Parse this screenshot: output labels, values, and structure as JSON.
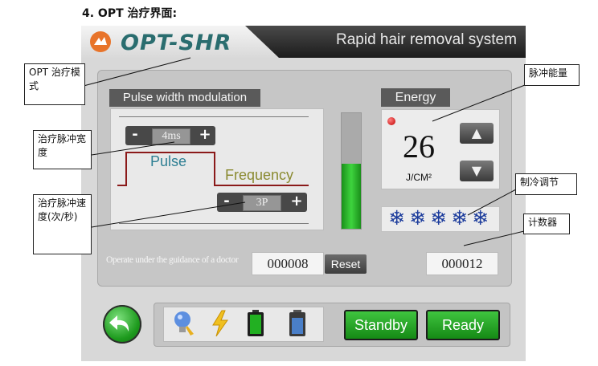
{
  "heading": "4. OPT 治疗界面:",
  "header": {
    "logo_text": "OPT-SHR",
    "subtitle": "Rapid hair removal system"
  },
  "pulse_width_modulation": {
    "label": "Pulse width modulation",
    "pulse_width_value": "4ms",
    "pulse_label": "Pulse",
    "frequency_label": "Frequency",
    "frequency_value": "3P",
    "minus": "-",
    "plus": "+"
  },
  "power_meter": {
    "level": 0.56,
    "color": "#2fb82f"
  },
  "energy": {
    "label": "Energy",
    "value": "26",
    "unit": "J/CM²",
    "up_icon": "triangle-up-icon",
    "down_icon": "triangle-down-icon"
  },
  "cooling": {
    "level_icons": [
      "snowflake-icon",
      "snowflake-icon",
      "snowflake-icon",
      "snowflake-icon",
      "snowflake-icon"
    ],
    "glyph": "❄"
  },
  "bottom": {
    "guidance": "Operate under the guidance of a doctor",
    "counter_1": "000008",
    "reset_label": "Reset",
    "counter_2": "000012"
  },
  "toolbar": {
    "icons": [
      "back-arrow-icon",
      "light-bulb-icon",
      "lightning-icon",
      "battery-icon",
      "water-tank-icon"
    ],
    "standby_label": "Standby",
    "ready_label": "Ready"
  },
  "callouts": {
    "mode": "OPT  治疗模式",
    "pulse_width": "治疗脉冲宽度",
    "pulse_speed": "治疗脉冲速度(次/秒)",
    "energy": "脉冲能量",
    "cooling": "制冷调节",
    "counter": "计数器"
  },
  "colors": {
    "accent_green": "#2fb82f",
    "panel_dark": "#5a5a5a",
    "snowflake_blue": "#1c3c9c",
    "waveform": "#8b1a1a"
  }
}
